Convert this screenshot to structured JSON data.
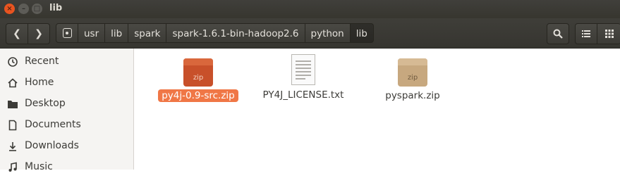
{
  "window": {
    "title": "lib"
  },
  "colors": {
    "accent": "#e95420",
    "selection": "#f07746",
    "zip_orange": "#c8502a",
    "zip_tan": "#c7a87f"
  },
  "toolbar": {
    "back_icon": "chevron-left-icon",
    "forward_icon": "chevron-right-icon",
    "breadcrumbs": [
      "usr",
      "lib",
      "spark",
      "spark-1.6.1-bin-hadoop2.6",
      "python",
      "lib"
    ],
    "search_icon": "search-icon",
    "list_view_icon": "list-view-icon",
    "grid_view_icon": "grid-view-icon"
  },
  "sidebar": {
    "items": [
      {
        "label": "Recent",
        "icon": "clock-icon"
      },
      {
        "label": "Home",
        "icon": "home-icon"
      },
      {
        "label": "Desktop",
        "icon": "folder-icon"
      },
      {
        "label": "Documents",
        "icon": "document-icon"
      },
      {
        "label": "Downloads",
        "icon": "download-icon"
      },
      {
        "label": "Music",
        "icon": "music-icon"
      }
    ]
  },
  "files": [
    {
      "name": "py4j-0.9-src.zip",
      "type": "zip",
      "badge": "zip",
      "selected": true
    },
    {
      "name": "PY4J_LICENSE.txt",
      "type": "txt",
      "selected": false
    },
    {
      "name": "pyspark.zip",
      "type": "zip",
      "badge": "zip",
      "selected": false
    }
  ]
}
